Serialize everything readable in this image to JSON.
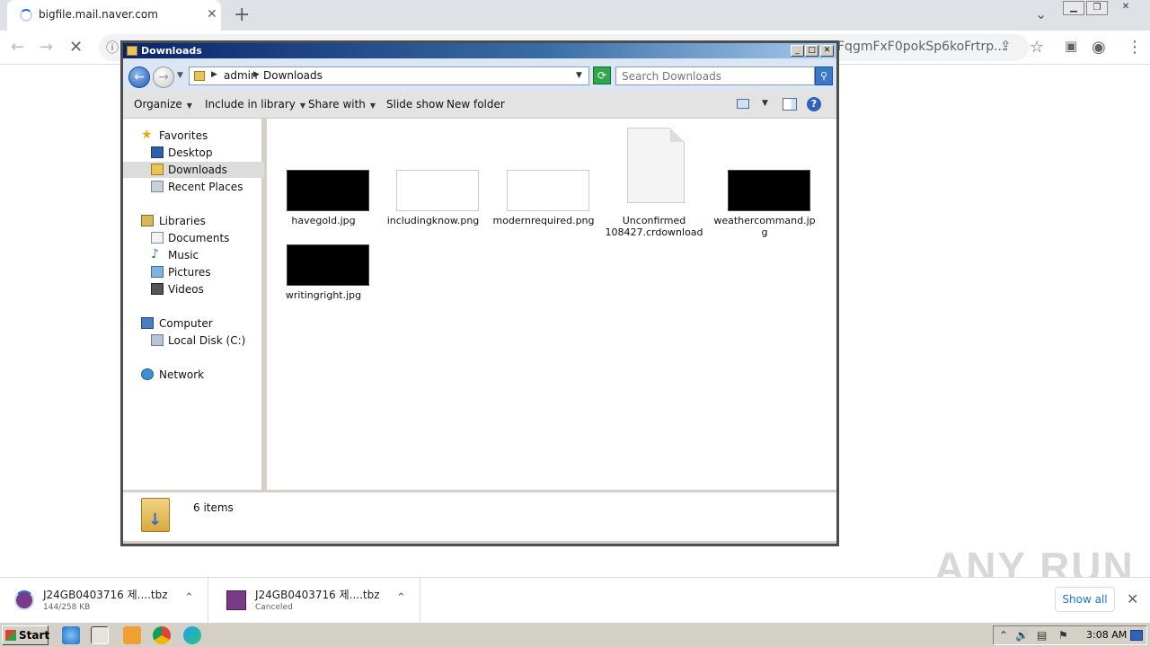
{
  "browser": {
    "tab_title": "bigfile.mail.naver.com",
    "url_tail": "FqgmFxF0pokSp6koFrtrp...",
    "icons": [
      "reload-spinner-icon",
      "back-icon",
      "forward-icon",
      "stop-icon",
      "info-icon",
      "share-icon",
      "star-icon",
      "side-panel-icon",
      "profile-icon",
      "menu-icon"
    ]
  },
  "explorer": {
    "title": "Downloads",
    "address": {
      "part1": "admin",
      "part2": "Downloads"
    },
    "search_placeholder": "Search Downloads",
    "commands": {
      "organize": "Organize",
      "include": "Include in library",
      "share": "Share with",
      "slideshow": "Slide show",
      "newfolder": "New folder"
    },
    "nav": {
      "favorites": "Favorites",
      "desktop": "Desktop",
      "downloads": "Downloads",
      "recent": "Recent Places",
      "libraries": "Libraries",
      "documents": "Documents",
      "music": "Music",
      "pictures": "Pictures",
      "videos": "Videos",
      "computer": "Computer",
      "localdisk": "Local Disk (C:)",
      "network": "Network"
    },
    "files": [
      {
        "name": "havegold.jpg",
        "thumb": "black"
      },
      {
        "name": "includingknow.png",
        "thumb": "white"
      },
      {
        "name": "modernrequired.png",
        "thumb": "white"
      },
      {
        "name": "Unconfirmed 108427.crdownload",
        "thumb": "document"
      },
      {
        "name": "weathercommand.jpg",
        "thumb": "black"
      },
      {
        "name": "writingright.jpg",
        "thumb": "black"
      }
    ],
    "status": "6 items"
  },
  "downloads": [
    {
      "name": "J24GB0403716  제....tbz",
      "status": "144/258 KB"
    },
    {
      "name": "J24GB0403716  제....tbz",
      "status": "Canceled"
    }
  ],
  "shelf": {
    "show_all": "Show all"
  },
  "watermark": "ANY RUN",
  "taskbar": {
    "start": "Start",
    "clock": "3:08 AM"
  },
  "colors": {
    "title_bar": "#0a246a",
    "accent": "#1a73e8",
    "taskbar": "#d4d0c8"
  }
}
